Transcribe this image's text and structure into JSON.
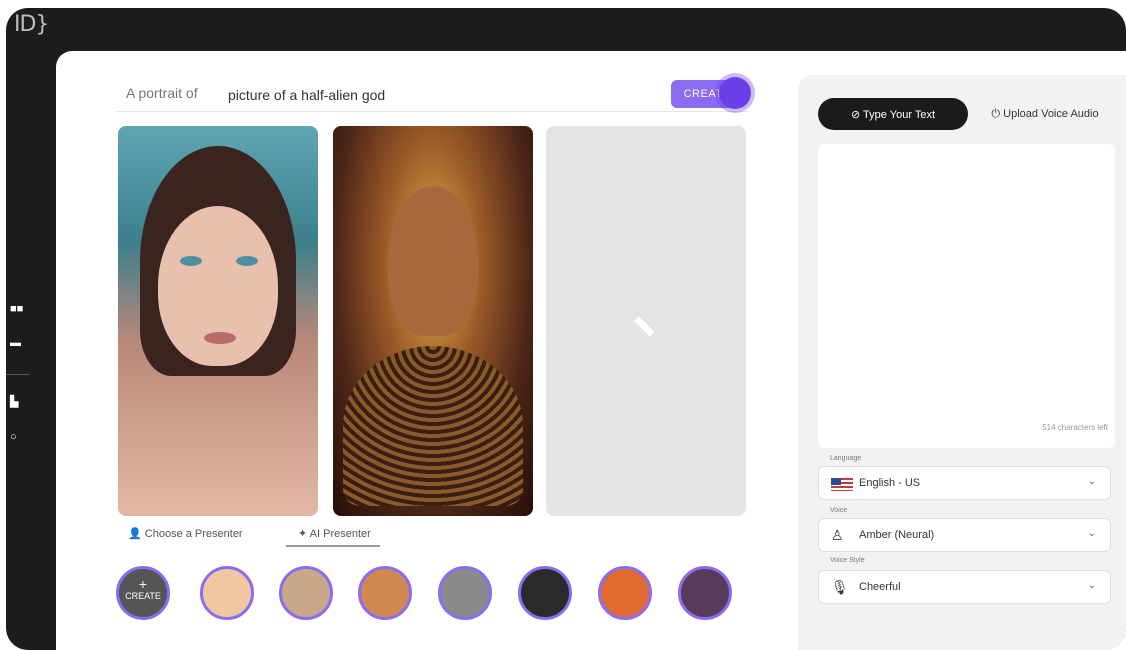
{
  "app": {
    "logo_text": "ID}"
  },
  "prompt": {
    "prefix": "A portrait of",
    "value": "picture of a half-alien god",
    "create_label": "CREATE"
  },
  "tabs": {
    "choose_presenter": "Choose a Presenter",
    "ai_presenter": "AI Presenter"
  },
  "avatars": {
    "create_label": "CREATE"
  },
  "right_panel": {
    "type_text_label": "Type Your Text",
    "upload_voice_label": "Upload Voice Audio",
    "characters_left": "514 characters left",
    "language_label": "Language",
    "language_value": "English - US",
    "voice_label": "Voice",
    "voice_value": "Amber (Neural)",
    "voice_style_label": "Voice Style",
    "voice_style_value": "Cheerful"
  },
  "colors": {
    "accent": "#8a6cf3",
    "frame": "#1c1c1c",
    "right_bg": "#f1f2f4"
  }
}
